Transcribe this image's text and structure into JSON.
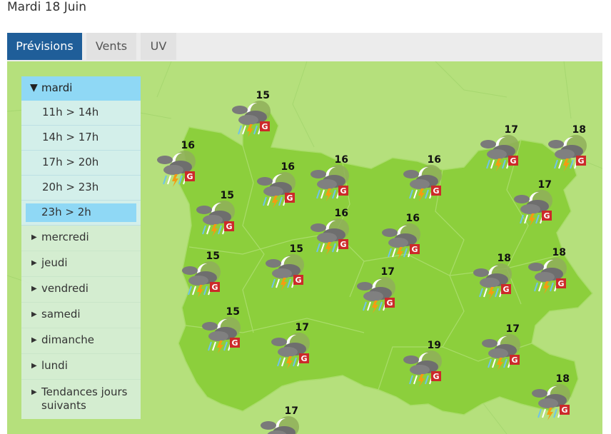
{
  "header": {
    "date": "Mardi 18 Juin"
  },
  "tabs": [
    {
      "label": "Prévisions",
      "active": true
    },
    {
      "label": "Vents",
      "active": false
    },
    {
      "label": "UV",
      "active": false
    }
  ],
  "sidebar": {
    "current_day": "mardi",
    "slots": [
      "11h > 14h",
      "14h > 17h",
      "17h > 20h",
      "20h > 23h",
      "23h > 2h"
    ],
    "selected_slot": "23h > 2h",
    "days": [
      "mercredi",
      "jeudi",
      "vendredi",
      "samedi",
      "dimanche",
      "lundi"
    ],
    "trends": "Tendances jours suivants"
  },
  "weather_icon": "night-thunderstorm-rain-hail-icon",
  "forecast_temps": [
    15,
    16,
    16,
    16,
    16,
    17,
    18,
    15,
    17,
    16,
    16,
    15,
    15,
    17,
    18,
    18,
    15,
    17,
    17,
    19,
    18,
    17
  ],
  "colors": {
    "tab_active": "#1f5e99",
    "map_bg": "#b5e07c",
    "region_fill": "#8ccf3c",
    "highlight": "#8fd8f5"
  }
}
